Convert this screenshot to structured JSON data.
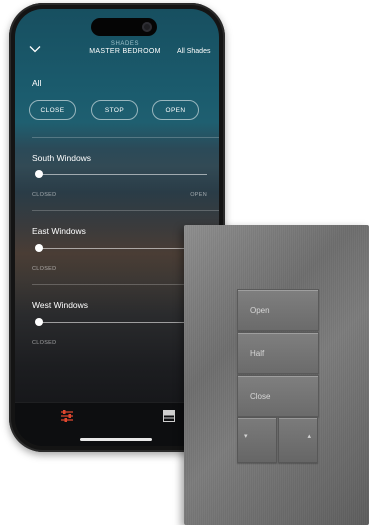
{
  "app": {
    "header": {
      "subtitle": "SHADES",
      "title": "MASTER BEDROOM",
      "right_link": "All Shades",
      "back_icon": "chevron-down-icon"
    },
    "all": {
      "label": "All",
      "buttons": [
        "CLOSE",
        "STOP",
        "OPEN"
      ]
    },
    "shades": [
      {
        "name": "South Windows",
        "closed_label": "CLOSED",
        "open_label": "OPEN",
        "position": 0
      },
      {
        "name": "East Windows",
        "closed_label": "CLOSED",
        "open_label": "",
        "position": 0
      },
      {
        "name": "West Windows",
        "closed_label": "CLOSED",
        "open_label": "",
        "position": 0
      }
    ],
    "tabbar": {
      "active_icon": "sliders-icon",
      "second_icon": "shade-icon",
      "accent_color": "#e0472f"
    }
  },
  "keypad": {
    "finish": "brushed nickel",
    "buttons": [
      "Open",
      "Half",
      "Close"
    ],
    "raise_glyph": "▴",
    "lower_glyph": "▾"
  }
}
